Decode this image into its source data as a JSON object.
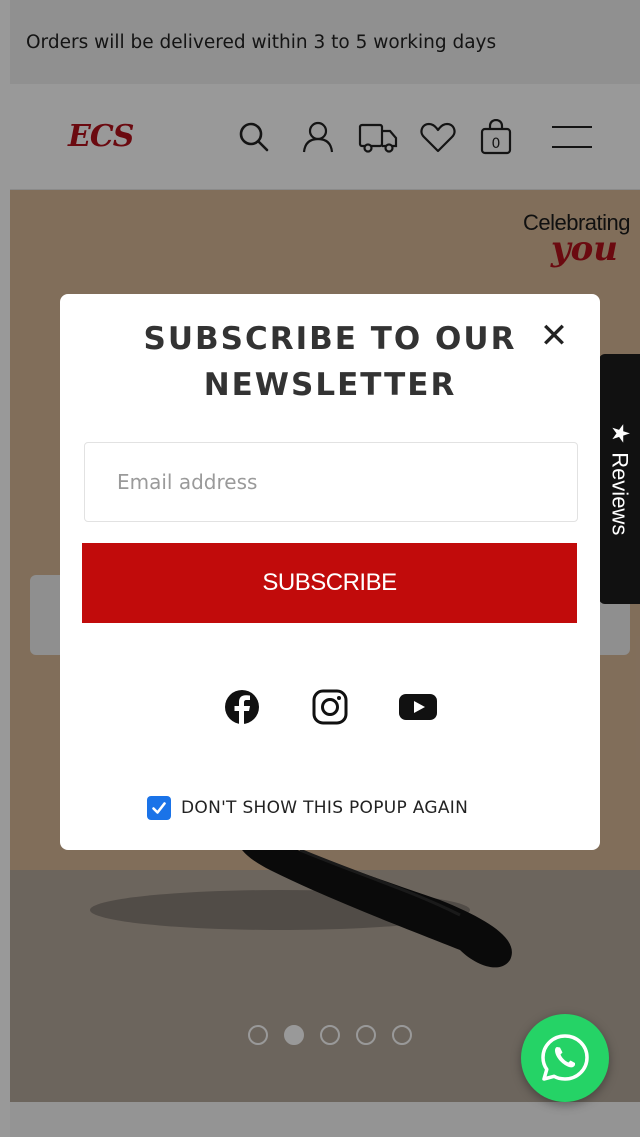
{
  "announcement": "Orders will be delivered within 3 to 5 working days",
  "header": {
    "logo": "ECS",
    "icons": [
      "search-icon",
      "user-icon",
      "truck-icon",
      "heart-icon",
      "bag-icon",
      "menu-icon"
    ],
    "cart_count": "0"
  },
  "hero": {
    "tagline_line1": "Celebrating",
    "tagline_line2": "you",
    "carousel_dots": 5,
    "active_dot": 2
  },
  "reviews_tab": {
    "label": "Reviews",
    "icon": "star-icon"
  },
  "popup": {
    "title": "SUBSCRIBE TO OUR NEWSLETTER",
    "close": "✕",
    "email_placeholder": "Email address",
    "subscribe_label": "SUBSCRIBE",
    "social": [
      "facebook-icon",
      "instagram-icon",
      "youtube-icon"
    ],
    "dont_show_label": "DON'T SHOW THIS POPUP AGAIN",
    "dont_show_checked": true
  },
  "whatsapp": {
    "icon": "whatsapp-icon"
  },
  "colors": {
    "brand_red": "#c10b0b",
    "whatsapp_green": "#25d366",
    "checkbox_blue": "#1a73e8"
  }
}
